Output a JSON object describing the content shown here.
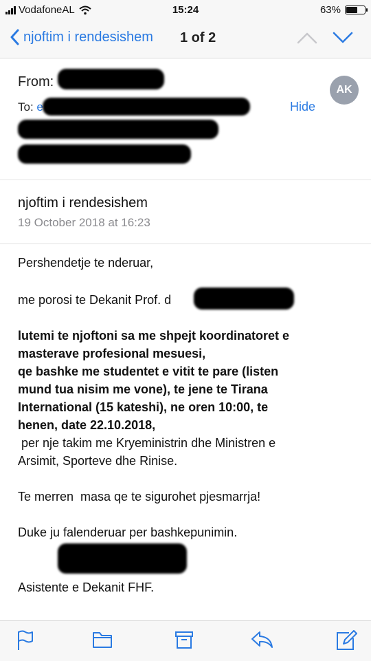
{
  "status_bar": {
    "carrier": "VodafoneAL",
    "time": "15:24",
    "battery_text": "63%",
    "battery_level": 0.63
  },
  "nav": {
    "back_label": "njoftim i rendesishem",
    "counter": "1 of 2"
  },
  "header": {
    "from_label": "From:",
    "to_label": "To:",
    "to_prefix": "e",
    "hide_label": "Hide",
    "avatar_initials": "AK"
  },
  "message": {
    "subject": "njoftim i rendesishem",
    "date": "19 October 2018 at 16:23"
  },
  "body": {
    "greeting": "Pershendetje te nderuar,",
    "porosi": "me porosi te Dekanit Prof.",
    "porosi_tail": "d",
    "bold_lines": [
      "lutemi te njoftoni sa me shpejt koordinatoret e",
      "masterave profesional mesuesi,",
      "qe bashke me studentet e vitit te pare (listen",
      "mund tua nisim me vone), te jene te Tirana",
      "International (15 kateshi), ne oren 10:00, te",
      "henen, date 22.10.2018,"
    ],
    "normal_lines": [
      " per nje takim me Kryeministrin dhe Ministren e",
      "Arsimit, Sporteve dhe Rinise."
    ],
    "line_masa": "Te merren  masa qe te sigurohet pjesmarrja!",
    "line_thanks": "Duke ju falenderuar per bashkepunimin.",
    "signature": "Asistente e Dekanit FHF."
  },
  "toolbar": {
    "icons": [
      "flag-icon",
      "folder-icon",
      "archive-icon",
      "reply-icon",
      "compose-icon"
    ]
  },
  "colors": {
    "accent": "#2a7ae2",
    "bar_bg": "#f7f7f7",
    "avatar_bg": "#9aa1ad",
    "secondary_text": "#8a8a8e"
  }
}
